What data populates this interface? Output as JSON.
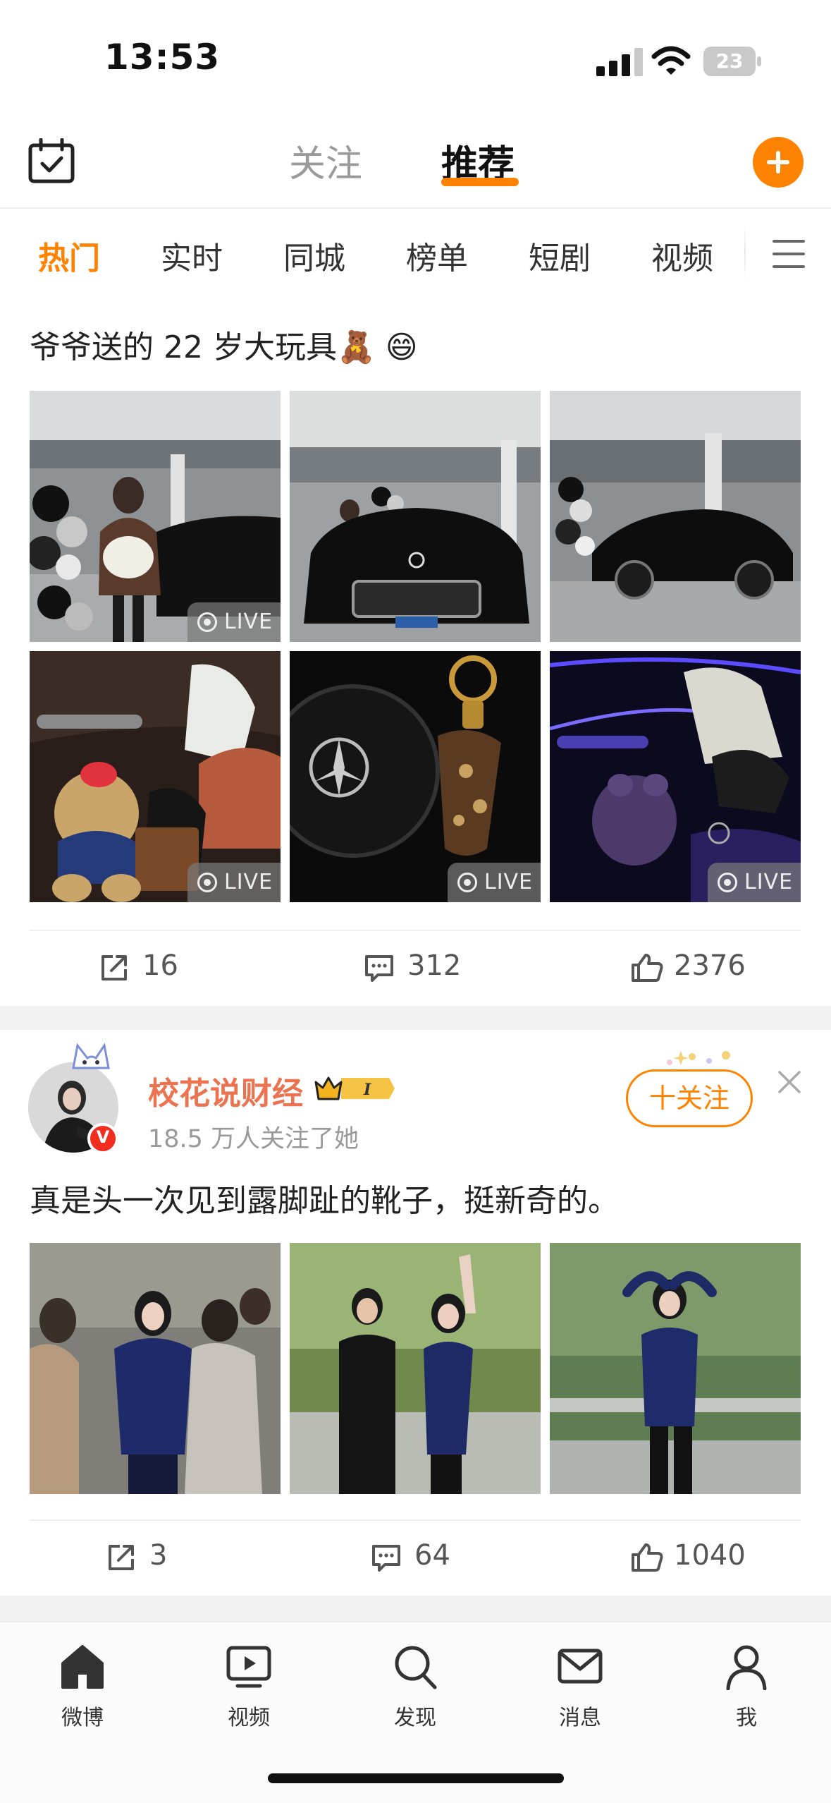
{
  "status_bar": {
    "time": "13:53",
    "battery": "23"
  },
  "header": {
    "tabs": [
      {
        "label": "关注",
        "active": false
      },
      {
        "label": "推荐",
        "active": true
      }
    ],
    "accent_color": "#ff8200"
  },
  "categories": [
    {
      "label": "热门",
      "active": true
    },
    {
      "label": "实时",
      "active": false
    },
    {
      "label": "同城",
      "active": false
    },
    {
      "label": "榜单",
      "active": false
    },
    {
      "label": "短剧",
      "active": false
    },
    {
      "label": "视频",
      "active": false
    }
  ],
  "posts": [
    {
      "text": "爷爷送的 22 岁大玩具🧸 😄",
      "photos": [
        {
          "scene": "showroom-portrait",
          "live": "LIVE"
        },
        {
          "scene": "showroom-car-front",
          "live": null
        },
        {
          "scene": "showroom-car-side",
          "live": null
        },
        {
          "scene": "interior-teddy-bear",
          "live": "LIVE"
        },
        {
          "scene": "steering-wheel-key",
          "live": "LIVE"
        },
        {
          "scene": "ambient-light-interior",
          "live": "LIVE"
        }
      ],
      "actions": {
        "reposts": "16",
        "comments": "312",
        "likes": "2376"
      }
    },
    {
      "author": {
        "name": "校花说财经",
        "level_badge": "I",
        "followers": "18.5 万人关注了她",
        "verified": "V"
      },
      "follow_label": "十关注",
      "text": "真是头一次见到露脚趾的靴子，挺新奇的。",
      "photos": [
        {
          "scene": "crowd-blue-outfit"
        },
        {
          "scene": "waving-park"
        },
        {
          "scene": "heart-pose-field"
        }
      ],
      "actions": {
        "reposts": "3",
        "comments": "64",
        "likes": "1040"
      }
    }
  ],
  "tab_bar": {
    "items": [
      {
        "label": "微博",
        "icon": "home-icon"
      },
      {
        "label": "视频",
        "icon": "video-icon"
      },
      {
        "label": "发现",
        "icon": "search-icon"
      },
      {
        "label": "消息",
        "icon": "mail-icon"
      },
      {
        "label": "我",
        "icon": "profile-icon"
      }
    ]
  }
}
